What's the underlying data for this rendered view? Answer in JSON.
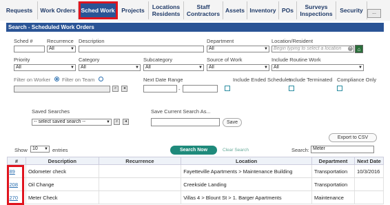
{
  "nav": {
    "tabs": [
      {
        "label": "Requests"
      },
      {
        "label": "Work Orders"
      },
      {
        "label": "Sched Work"
      },
      {
        "label": "Projects"
      },
      {
        "label": "Locations Residents"
      },
      {
        "label": "Staff Contractors"
      },
      {
        "label": "Assets"
      },
      {
        "label": "Inventory"
      },
      {
        "label": "POs"
      },
      {
        "label": "Surveys Inspections"
      },
      {
        "label": "Security"
      }
    ],
    "more_label": "...",
    "active_tab": "Sched Work"
  },
  "panel": {
    "title": "Search - Scheduled Work Orders"
  },
  "filters": {
    "sched_label": "Sched #",
    "recurrence_label": "Recurrence",
    "recurrence_value": "All",
    "description_label": "Description",
    "department_label": "Department",
    "department_value": "All",
    "location_label": "Location/Resident",
    "location_placeholder": "Begin typing to select a location",
    "priority_label": "Priority",
    "priority_value": "All",
    "category_label": "Category",
    "category_value": "All",
    "subcategory_label": "Subcategory",
    "subcategory_value": "All",
    "source_label": "Source of Work",
    "source_value": "All",
    "include_routine_label": "Include Routine Work",
    "include_routine_value": "All",
    "filter_worker_label": "Filter on Worker",
    "filter_team_label": "Filter on Team",
    "next_date_label": "Next Date Range",
    "date_separator": "-",
    "include_ended_label": "Include Ended Schedules",
    "include_terminated_label": "Include Terminated",
    "compliance_label": "Compliance Only"
  },
  "saved": {
    "saved_searches_label": "Saved Searches",
    "saved_select_value": "-- select saved search --",
    "save_current_label": "Save Current Search As...",
    "save_button": "Save"
  },
  "actions": {
    "export_label": "Export to CSV",
    "search_now": "Search Now",
    "clear_search": "Clear Search"
  },
  "table_controls": {
    "show_label": "Show",
    "entries_value": "10",
    "entries_label": "entries",
    "search_label": "Search:",
    "search_value": "Meter"
  },
  "table": {
    "headers": [
      "#",
      "Description",
      "Recurrence",
      "Location",
      "Department",
      "Next Date"
    ],
    "rows": [
      {
        "id": "89",
        "description": "Odometer check",
        "recurrence": "",
        "location": "Fayetteville Apartments > Maintenance Building",
        "department": "Transportation",
        "next_date": "10/3/2016"
      },
      {
        "id": "208",
        "description": "Oil Change",
        "recurrence": "",
        "location": "Creekside Landing",
        "department": "Transportation",
        "next_date": ""
      },
      {
        "id": "270",
        "description": "Meter Check",
        "recurrence": "",
        "location": "Villas 4 > Blount St > 1. Barger Apartments",
        "department": "Maintenance",
        "next_date": ""
      }
    ]
  },
  "colors": {
    "brand_blue": "#2a5496",
    "highlight_red": "#e0141e",
    "search_button_green": "#1f8a7b"
  }
}
